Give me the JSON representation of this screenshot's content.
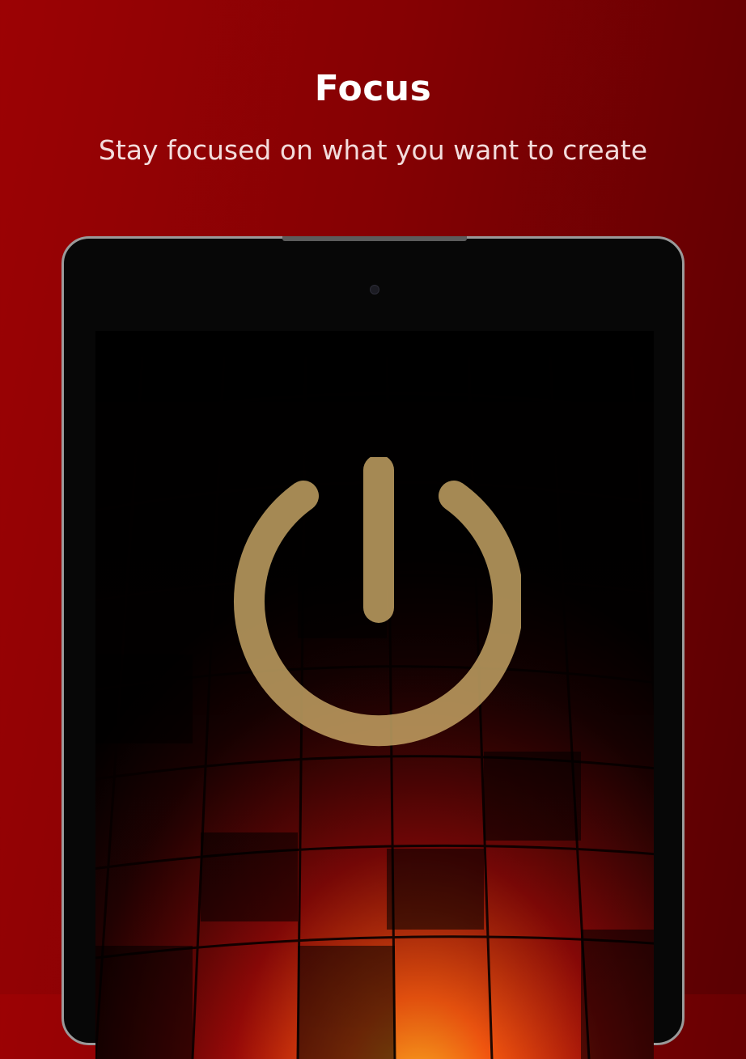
{
  "header": {
    "title": "Focus",
    "subtitle": "Stay focused on what you want to create"
  },
  "device": {
    "power_icon": "power-icon",
    "power_color": "#c9a766",
    "background_image": "hot-air-balloon-envelope"
  },
  "colors": {
    "background_start": "#9c0204",
    "background_end": "#5a0002"
  }
}
